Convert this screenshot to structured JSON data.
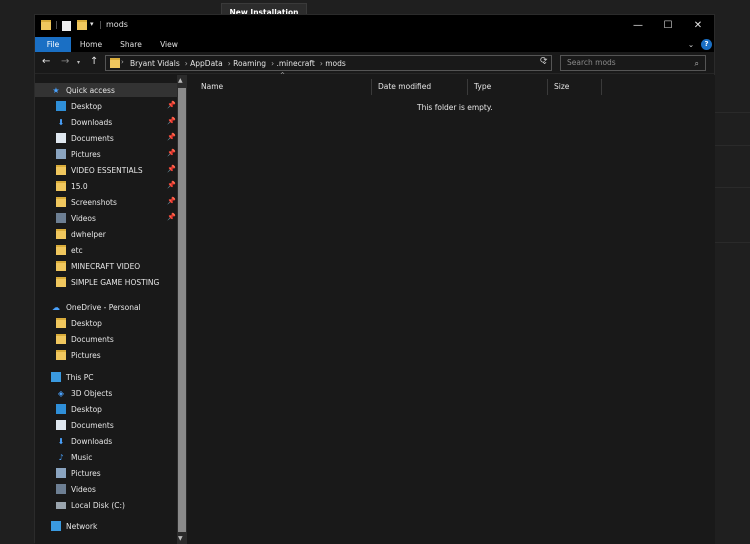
{
  "background": {
    "button_label": "New Installation"
  },
  "window": {
    "title": "mods",
    "controls": {
      "minimize": "—",
      "maximize": "☐",
      "close": "✕"
    }
  },
  "ribbon": {
    "tabs": [
      "File",
      "Home",
      "Share",
      "View"
    ]
  },
  "address": {
    "breadcrumbs": [
      "Bryant Vidals",
      "AppData",
      "Roaming",
      ".minecraft",
      "mods"
    ],
    "search_placeholder": "Search mods"
  },
  "columns": [
    "Name",
    "Date modified",
    "Type",
    "Size"
  ],
  "empty_message": "This folder is empty.",
  "nav": {
    "quick_access": {
      "label": "Quick access",
      "items": [
        {
          "label": "Desktop",
          "icon": "desktop-icon",
          "pinned": true
        },
        {
          "label": "Downloads",
          "icon": "download-icon",
          "pinned": true
        },
        {
          "label": "Documents",
          "icon": "documents-icon",
          "pinned": true
        },
        {
          "label": "Pictures",
          "icon": "pictures-icon",
          "pinned": true
        },
        {
          "label": "VIDEO ESSENTIALS",
          "icon": "folder-icon",
          "pinned": true
        },
        {
          "label": "15.0",
          "icon": "folder-icon",
          "pinned": true
        },
        {
          "label": "Screenshots",
          "icon": "folder-icon",
          "pinned": true
        },
        {
          "label": "Videos",
          "icon": "videos-icon",
          "pinned": true
        },
        {
          "label": "dwhelper",
          "icon": "folder-icon",
          "pinned": false
        },
        {
          "label": "etc",
          "icon": "folder-icon",
          "pinned": false
        },
        {
          "label": "MINECRAFT VIDEO",
          "icon": "folder-icon",
          "pinned": false
        },
        {
          "label": "SIMPLE GAME HOSTING",
          "icon": "folder-icon",
          "pinned": false
        }
      ]
    },
    "onedrive": {
      "label": "OneDrive - Personal",
      "items": [
        "Desktop",
        "Documents",
        "Pictures"
      ]
    },
    "this_pc": {
      "label": "This PC",
      "items": [
        "3D Objects",
        "Desktop",
        "Documents",
        "Downloads",
        "Music",
        "Pictures",
        "Videos",
        "Local Disk (C:)"
      ]
    },
    "network": {
      "label": "Network"
    }
  },
  "colors": {
    "accent": "#1a6fc4",
    "folder": "#f0c75e",
    "background": "#191919"
  }
}
